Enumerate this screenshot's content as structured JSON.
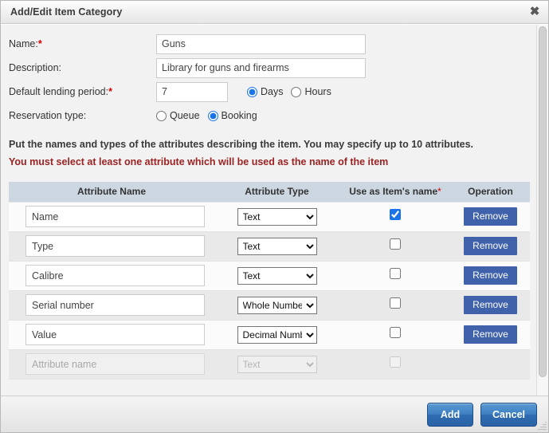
{
  "dialog": {
    "title": "Add/Edit Item Category",
    "close_icon": "close-icon",
    "close_glyph": "✖"
  },
  "form": {
    "name": {
      "label": "Name:",
      "required_marker": "*",
      "value": "Guns",
      "placeholder": ""
    },
    "description": {
      "label": "Description:",
      "value": "Library for guns and firearms",
      "placeholder": ""
    },
    "lending_period": {
      "label": "Default lending period:",
      "required_marker": "*",
      "value": "7",
      "placeholder": "",
      "units": [
        {
          "label": "Days",
          "selected": true
        },
        {
          "label": "Hours",
          "selected": false
        }
      ]
    },
    "reservation_type": {
      "label": "Reservation type:",
      "options": [
        {
          "label": "Queue",
          "selected": false
        },
        {
          "label": "Booking",
          "selected": true
        }
      ]
    }
  },
  "notes": {
    "instruction": "Put the names and types of the attributes describing the item. You may specify up to 10 attributes.",
    "warning": "You must select at least one attribute which will be used as the name of the item"
  },
  "attributes_table": {
    "columns": [
      {
        "label": "Attribute Name"
      },
      {
        "label": "Attribute Type"
      },
      {
        "label": "Use as Item's name",
        "required_marker": "*"
      },
      {
        "label": "Operation"
      }
    ],
    "type_options": [
      "Text",
      "Whole Number",
      "Decimal Number"
    ],
    "remove_label": "Remove",
    "name_placeholder": "Attribute name",
    "rows": [
      {
        "name": "Name",
        "placeholder": "Attribute name",
        "type": "Text",
        "use_as_name": true,
        "removable": true,
        "disabled": false
      },
      {
        "name": "Type",
        "placeholder": "Attribute name",
        "type": "Text",
        "use_as_name": false,
        "removable": true,
        "disabled": false
      },
      {
        "name": "Calibre",
        "placeholder": "Attribute name",
        "type": "Text",
        "use_as_name": false,
        "removable": true,
        "disabled": false
      },
      {
        "name": "Serial number",
        "placeholder": "Attribute name",
        "type": "Whole Number",
        "use_as_name": false,
        "removable": true,
        "disabled": false
      },
      {
        "name": "Value",
        "placeholder": "Attribute name",
        "type": "Decimal Number",
        "use_as_name": false,
        "removable": true,
        "disabled": false
      },
      {
        "name": "",
        "placeholder": "Attribute name",
        "type": "Text",
        "use_as_name": false,
        "removable": false,
        "disabled": true
      }
    ]
  },
  "footer": {
    "add_label": "Add",
    "cancel_label": "Cancel"
  },
  "colors": {
    "accent_blue": "#3f62ab",
    "button_blue": "#2e6bb0",
    "table_header": "#ccd7e2",
    "warning_red": "#9b2323",
    "required_red": "#d40000"
  }
}
